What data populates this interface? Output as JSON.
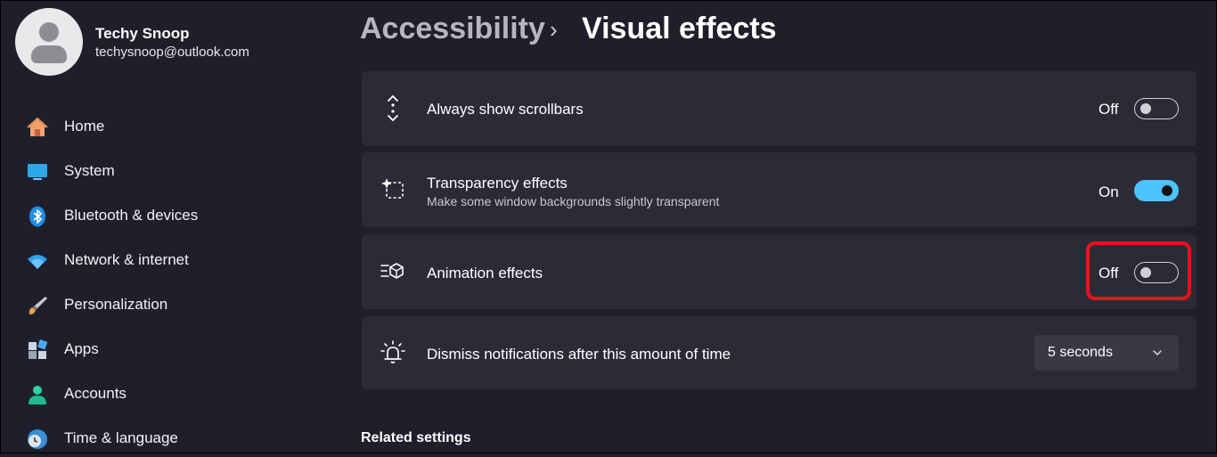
{
  "user": {
    "name": "Techy Snoop",
    "email": "techysnoop@outlook.com"
  },
  "sidebar": {
    "items": [
      {
        "label": "Home",
        "icon": "home-icon"
      },
      {
        "label": "System",
        "icon": "system-icon"
      },
      {
        "label": "Bluetooth & devices",
        "icon": "bluetooth-icon"
      },
      {
        "label": "Network & internet",
        "icon": "wifi-icon"
      },
      {
        "label": "Personalization",
        "icon": "brush-icon"
      },
      {
        "label": "Apps",
        "icon": "apps-icon"
      },
      {
        "label": "Accounts",
        "icon": "accounts-icon"
      },
      {
        "label": "Time & language",
        "icon": "clock-globe-icon"
      }
    ]
  },
  "header": {
    "parent": "Accessibility",
    "separator": "›",
    "current": "Visual effects"
  },
  "settings": [
    {
      "title": "Always show scrollbars",
      "description": "",
      "state": "Off",
      "icon": "scrollbar-icon"
    },
    {
      "title": "Transparency effects",
      "description": "Make some window backgrounds slightly transparent",
      "state": "On",
      "icon": "transparency-icon"
    },
    {
      "title": "Animation effects",
      "description": "",
      "state": "Off",
      "icon": "animation-icon"
    },
    {
      "title": "Dismiss notifications after this amount of time",
      "description": "",
      "value": "5 seconds",
      "icon": "notification-bell-icon"
    }
  ],
  "related": {
    "title": "Related settings"
  },
  "colors": {
    "background": "#1f1f2c",
    "card": "#2b2b38",
    "accent": "#4cc2ff",
    "highlight": "#e8121c"
  }
}
